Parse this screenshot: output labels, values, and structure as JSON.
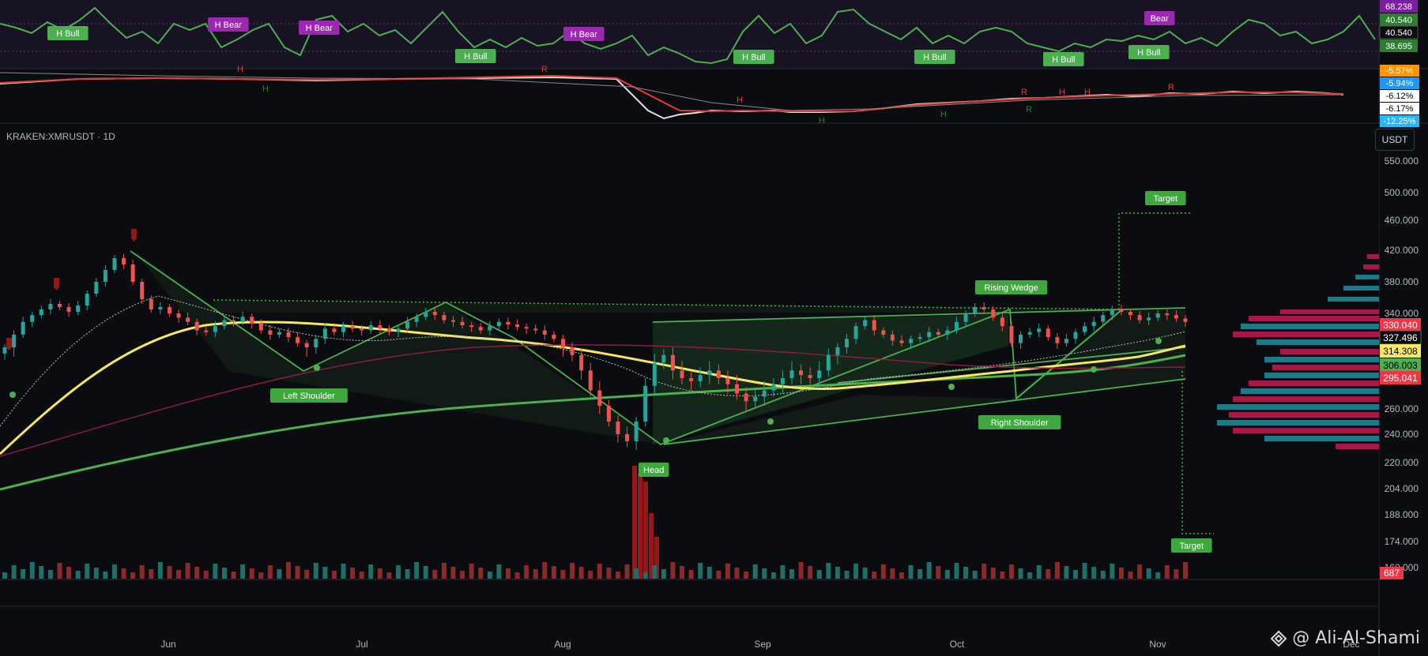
{
  "symbol_label": "KRAKEN:XMRUSDT · 1D",
  "currency": "USDT",
  "watermark": "@ Ali-Al-Shami",
  "colors": {
    "background": "#0b0c10",
    "up_candle": "#26a69a",
    "down_candle": "#ef5350",
    "pattern_green": "#4caf50",
    "yellow_ma": "#f5e663",
    "purple_label": "#9c27b0"
  },
  "chart_data": [
    {
      "type": "line",
      "panel": "oscillator-rsi",
      "series": [],
      "price_scale_labels": [
        "68.238",
        "40.540",
        "40.540",
        "38.695"
      ],
      "annotations": [
        "H Bull",
        "H Bear",
        "H Bear",
        "H Bull",
        "H Bear",
        "H Bull",
        "H Bull",
        "H Bull",
        "H Bull",
        "Bear"
      ]
    },
    {
      "type": "line",
      "panel": "oscillator-percent",
      "series": [],
      "price_scale_labels": [
        "-5.57%",
        "-5.94%",
        "-6.12%",
        "-6.17%",
        "-12.25%"
      ],
      "annotations": [
        "H",
        "R",
        "H",
        "H",
        "H",
        "H",
        "R",
        "R",
        "H",
        "H",
        "R",
        "H",
        "R"
      ]
    },
    {
      "type": "candlestick",
      "panel": "main-price",
      "title": "KRAKEN:XMRUSDT · 1D",
      "x_tick_labels": [
        "Jun",
        "Jul",
        "Aug",
        "Sep",
        "Oct",
        "Nov",
        "Dec"
      ],
      "y_tick_labels": [
        "550.000",
        "500.000",
        "460.000",
        "420.000",
        "380.000",
        "340.000",
        "300.000",
        "260.000",
        "240.000",
        "220.000",
        "204.000",
        "188.000",
        "174.000",
        "160.000"
      ],
      "ylim": [
        156,
        560
      ],
      "current_price_labels": [
        "330.040",
        "327.496",
        "314.308",
        "306.003",
        "295.041"
      ],
      "volume_label": "687",
      "pattern_labels": [
        "Left Shoulder",
        "Head",
        "Right Shoulder",
        "Rising Wedge",
        "Target",
        "Target"
      ],
      "close_series": [
        300,
        315,
        330,
        338,
        345,
        352,
        348,
        342,
        350,
        365,
        380,
        395,
        410,
        402,
        380,
        358,
        345,
        348,
        340,
        335,
        330,
        320,
        318,
        325,
        332,
        330,
        336,
        328,
        320,
        315,
        318,
        312,
        305,
        300,
        310,
        322,
        318,
        325,
        322,
        320,
        326,
        322,
        318,
        322,
        330,
        336,
        342,
        338,
        332,
        330,
        326,
        324,
        320,
        325,
        330,
        327,
        324,
        322,
        320,
        315,
        310,
        300,
        295,
        285,
        272,
        262,
        250,
        240,
        235,
        250,
        275,
        290,
        295,
        285,
        280,
        278,
        282,
        285,
        280,
        276,
        270,
        265,
        268,
        272,
        276,
        280,
        285,
        282,
        280,
        285,
        295,
        300,
        310,
        325,
        332,
        320,
        315,
        308,
        305,
        310,
        312,
        318,
        315,
        320,
        330,
        340,
        348,
        345,
        335,
        325,
        305,
        315,
        318,
        322,
        312,
        305,
        310,
        318,
        325,
        330,
        338,
        345,
        342,
        338,
        332,
        335,
        340,
        338,
        334,
        330
      ]
    }
  ]
}
